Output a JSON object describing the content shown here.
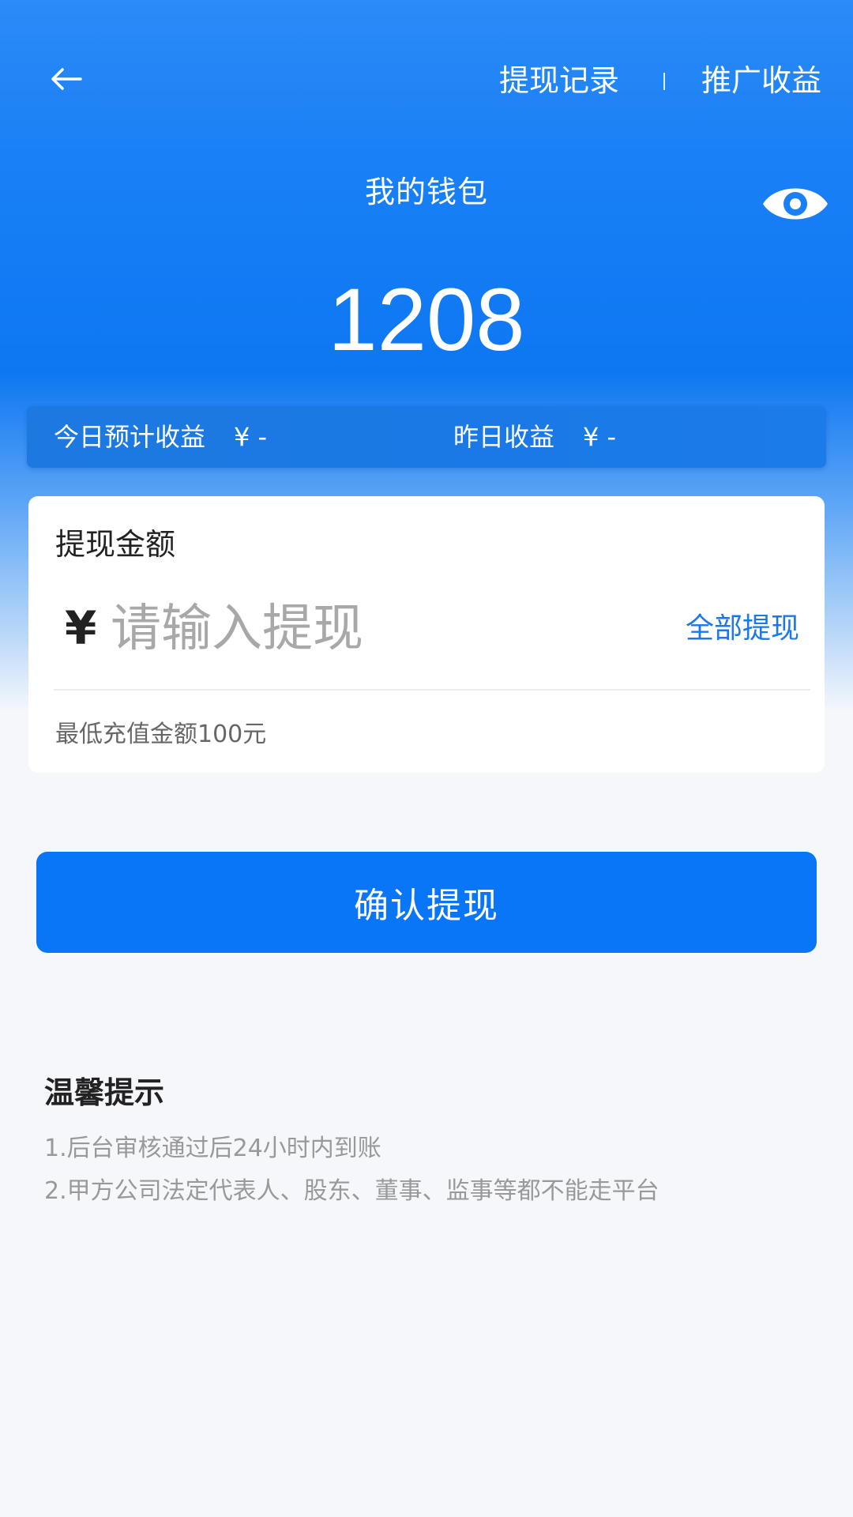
{
  "header": {
    "records_label": "提现记录",
    "promo_label": "推广收益"
  },
  "wallet": {
    "title": "我的钱包",
    "balance": "1208"
  },
  "earnings": {
    "today_label": "今日预计收益",
    "today_value": "¥ -",
    "yesterday_label": "昨日收益",
    "yesterday_value": "¥ -"
  },
  "withdraw": {
    "label": "提现金额",
    "currency_symbol": "¥",
    "input_placeholder": "请输入提现",
    "input_value": "",
    "withdraw_all_label": "全部提现",
    "min_note": "最低充值金额100元",
    "confirm_label": "确认提现"
  },
  "tips": {
    "title": "温馨提示",
    "items": [
      "1.后台审核通过后24小时内到账",
      "2.甲方公司法定代表人、股东、董事、监事等都不能走平台"
    ]
  },
  "colors": {
    "primary": "#0876f6",
    "link": "#1a78e8",
    "background": "#f5f7fb"
  },
  "icons": {
    "back": "back-arrow-icon",
    "visibility": "eye-icon"
  }
}
